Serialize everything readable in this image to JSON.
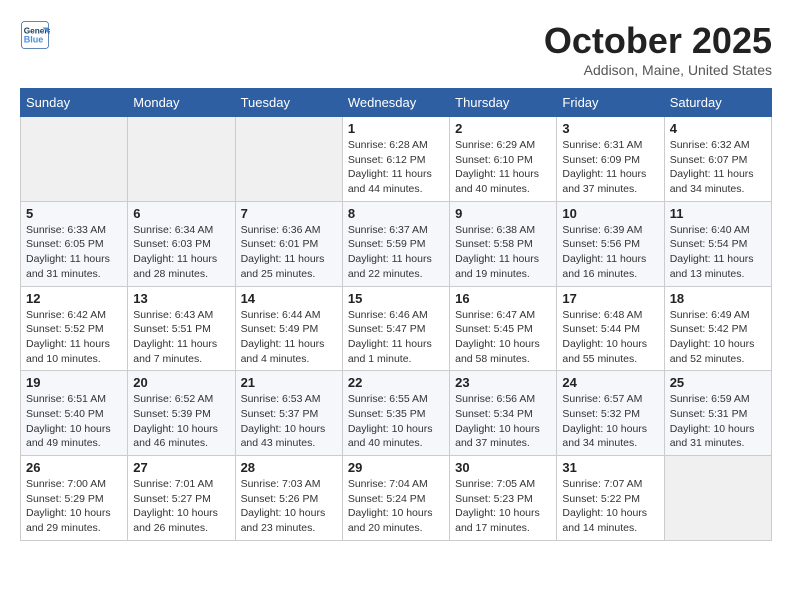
{
  "header": {
    "logo_line1": "General",
    "logo_line2": "Blue",
    "month": "October 2025",
    "location": "Addison, Maine, United States"
  },
  "weekdays": [
    "Sunday",
    "Monday",
    "Tuesday",
    "Wednesday",
    "Thursday",
    "Friday",
    "Saturday"
  ],
  "weeks": [
    [
      {
        "day": "",
        "info": ""
      },
      {
        "day": "",
        "info": ""
      },
      {
        "day": "",
        "info": ""
      },
      {
        "day": "1",
        "info": "Sunrise: 6:28 AM\nSunset: 6:12 PM\nDaylight: 11 hours and 44 minutes."
      },
      {
        "day": "2",
        "info": "Sunrise: 6:29 AM\nSunset: 6:10 PM\nDaylight: 11 hours and 40 minutes."
      },
      {
        "day": "3",
        "info": "Sunrise: 6:31 AM\nSunset: 6:09 PM\nDaylight: 11 hours and 37 minutes."
      },
      {
        "day": "4",
        "info": "Sunrise: 6:32 AM\nSunset: 6:07 PM\nDaylight: 11 hours and 34 minutes."
      }
    ],
    [
      {
        "day": "5",
        "info": "Sunrise: 6:33 AM\nSunset: 6:05 PM\nDaylight: 11 hours and 31 minutes."
      },
      {
        "day": "6",
        "info": "Sunrise: 6:34 AM\nSunset: 6:03 PM\nDaylight: 11 hours and 28 minutes."
      },
      {
        "day": "7",
        "info": "Sunrise: 6:36 AM\nSunset: 6:01 PM\nDaylight: 11 hours and 25 minutes."
      },
      {
        "day": "8",
        "info": "Sunrise: 6:37 AM\nSunset: 5:59 PM\nDaylight: 11 hours and 22 minutes."
      },
      {
        "day": "9",
        "info": "Sunrise: 6:38 AM\nSunset: 5:58 PM\nDaylight: 11 hours and 19 minutes."
      },
      {
        "day": "10",
        "info": "Sunrise: 6:39 AM\nSunset: 5:56 PM\nDaylight: 11 hours and 16 minutes."
      },
      {
        "day": "11",
        "info": "Sunrise: 6:40 AM\nSunset: 5:54 PM\nDaylight: 11 hours and 13 minutes."
      }
    ],
    [
      {
        "day": "12",
        "info": "Sunrise: 6:42 AM\nSunset: 5:52 PM\nDaylight: 11 hours and 10 minutes."
      },
      {
        "day": "13",
        "info": "Sunrise: 6:43 AM\nSunset: 5:51 PM\nDaylight: 11 hours and 7 minutes."
      },
      {
        "day": "14",
        "info": "Sunrise: 6:44 AM\nSunset: 5:49 PM\nDaylight: 11 hours and 4 minutes."
      },
      {
        "day": "15",
        "info": "Sunrise: 6:46 AM\nSunset: 5:47 PM\nDaylight: 11 hours and 1 minute."
      },
      {
        "day": "16",
        "info": "Sunrise: 6:47 AM\nSunset: 5:45 PM\nDaylight: 10 hours and 58 minutes."
      },
      {
        "day": "17",
        "info": "Sunrise: 6:48 AM\nSunset: 5:44 PM\nDaylight: 10 hours and 55 minutes."
      },
      {
        "day": "18",
        "info": "Sunrise: 6:49 AM\nSunset: 5:42 PM\nDaylight: 10 hours and 52 minutes."
      }
    ],
    [
      {
        "day": "19",
        "info": "Sunrise: 6:51 AM\nSunset: 5:40 PM\nDaylight: 10 hours and 49 minutes."
      },
      {
        "day": "20",
        "info": "Sunrise: 6:52 AM\nSunset: 5:39 PM\nDaylight: 10 hours and 46 minutes."
      },
      {
        "day": "21",
        "info": "Sunrise: 6:53 AM\nSunset: 5:37 PM\nDaylight: 10 hours and 43 minutes."
      },
      {
        "day": "22",
        "info": "Sunrise: 6:55 AM\nSunset: 5:35 PM\nDaylight: 10 hours and 40 minutes."
      },
      {
        "day": "23",
        "info": "Sunrise: 6:56 AM\nSunset: 5:34 PM\nDaylight: 10 hours and 37 minutes."
      },
      {
        "day": "24",
        "info": "Sunrise: 6:57 AM\nSunset: 5:32 PM\nDaylight: 10 hours and 34 minutes."
      },
      {
        "day": "25",
        "info": "Sunrise: 6:59 AM\nSunset: 5:31 PM\nDaylight: 10 hours and 31 minutes."
      }
    ],
    [
      {
        "day": "26",
        "info": "Sunrise: 7:00 AM\nSunset: 5:29 PM\nDaylight: 10 hours and 29 minutes."
      },
      {
        "day": "27",
        "info": "Sunrise: 7:01 AM\nSunset: 5:27 PM\nDaylight: 10 hours and 26 minutes."
      },
      {
        "day": "28",
        "info": "Sunrise: 7:03 AM\nSunset: 5:26 PM\nDaylight: 10 hours and 23 minutes."
      },
      {
        "day": "29",
        "info": "Sunrise: 7:04 AM\nSunset: 5:24 PM\nDaylight: 10 hours and 20 minutes."
      },
      {
        "day": "30",
        "info": "Sunrise: 7:05 AM\nSunset: 5:23 PM\nDaylight: 10 hours and 17 minutes."
      },
      {
        "day": "31",
        "info": "Sunrise: 7:07 AM\nSunset: 5:22 PM\nDaylight: 10 hours and 14 minutes."
      },
      {
        "day": "",
        "info": ""
      }
    ]
  ]
}
